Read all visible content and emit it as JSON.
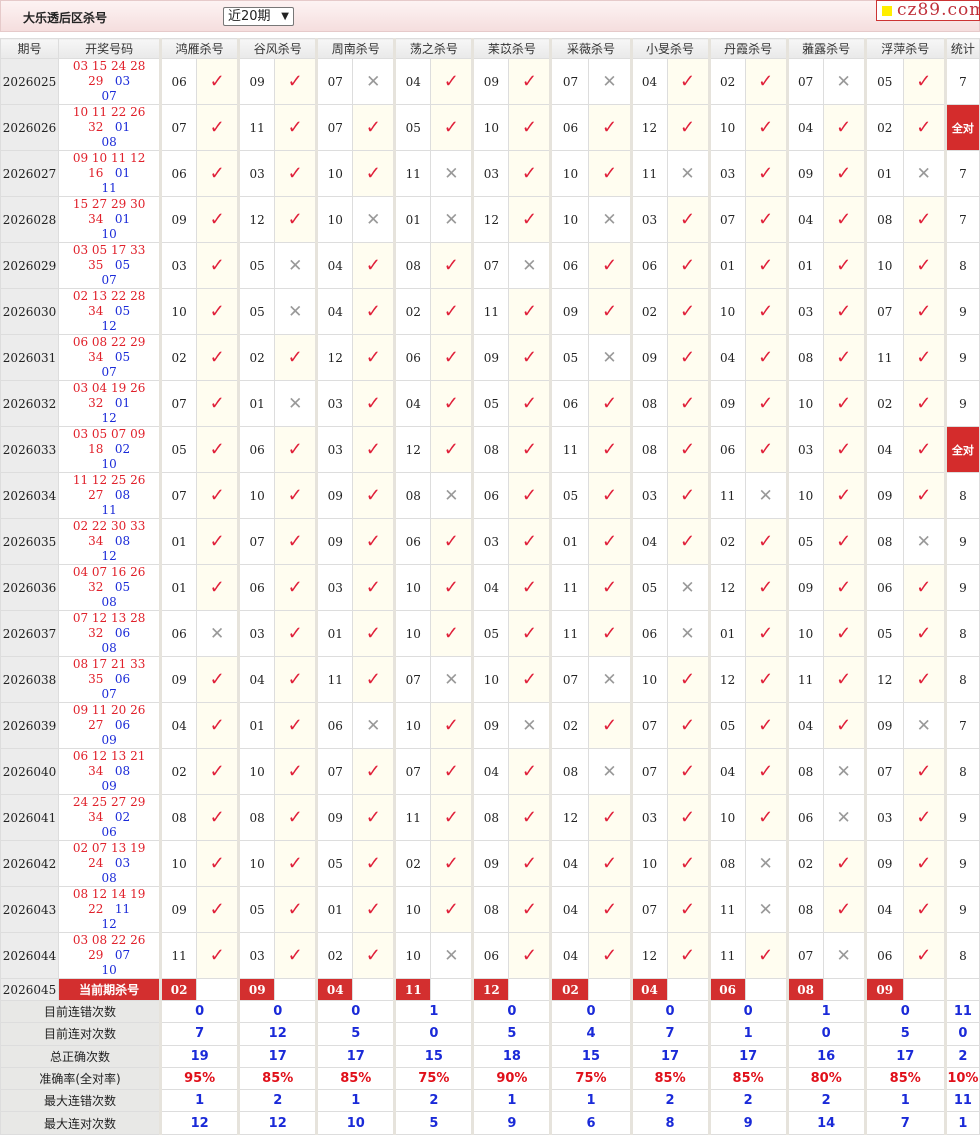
{
  "header": {
    "title": "大乐透后区杀号",
    "period_select": "近20期",
    "logo": "cz89.com"
  },
  "columns": {
    "period": "期号",
    "draw": "开奖号码",
    "stat": "统计"
  },
  "predictors": [
    "鸿雁杀号",
    "谷风杀号",
    "周南杀号",
    "荡之杀号",
    "苿苡杀号",
    "采薇杀号",
    "小旻杀号",
    "丹霞杀号",
    "蕥露杀号",
    "浮萍杀号"
  ],
  "rows": [
    {
      "period": "2026025",
      "red": "03 15 24 28 29",
      "blue": [
        "03",
        "07"
      ],
      "kills": [
        "06",
        "09",
        "07",
        "04",
        "09",
        "07",
        "04",
        "02",
        "07",
        "05"
      ],
      "stat": "7"
    },
    {
      "period": "2026026",
      "red": "10 11 22 26 32",
      "blue": [
        "01",
        "08"
      ],
      "kills": [
        "07",
        "11",
        "07",
        "05",
        "10",
        "06",
        "12",
        "10",
        "04",
        "02"
      ],
      "stat": "全对"
    },
    {
      "period": "2026027",
      "red": "09 10 11 12 16",
      "blue": [
        "01",
        "11"
      ],
      "kills": [
        "06",
        "03",
        "10",
        "11",
        "03",
        "10",
        "11",
        "03",
        "09",
        "01"
      ],
      "stat": "7"
    },
    {
      "period": "2026028",
      "red": "15 27 29 30 34",
      "blue": [
        "01",
        "10"
      ],
      "kills": [
        "09",
        "12",
        "10",
        "01",
        "12",
        "10",
        "03",
        "07",
        "04",
        "08"
      ],
      "stat": "7"
    },
    {
      "period": "2026029",
      "red": "03 05 17 33 35",
      "blue": [
        "05",
        "07"
      ],
      "kills": [
        "03",
        "05",
        "04",
        "08",
        "07",
        "06",
        "06",
        "01",
        "01",
        "10"
      ],
      "stat": "8"
    },
    {
      "period": "2026030",
      "red": "02 13 22 28 34",
      "blue": [
        "05",
        "12"
      ],
      "kills": [
        "10",
        "05",
        "04",
        "02",
        "11",
        "09",
        "02",
        "10",
        "03",
        "07"
      ],
      "stat": "9"
    },
    {
      "period": "2026031",
      "red": "06 08 22 29 34",
      "blue": [
        "05",
        "07"
      ],
      "kills": [
        "02",
        "02",
        "12",
        "06",
        "09",
        "05",
        "09",
        "04",
        "08",
        "11"
      ],
      "stat": "9"
    },
    {
      "period": "2026032",
      "red": "03 04 19 26 32",
      "blue": [
        "01",
        "12"
      ],
      "kills": [
        "07",
        "01",
        "03",
        "04",
        "05",
        "06",
        "08",
        "09",
        "10",
        "02"
      ],
      "stat": "9"
    },
    {
      "period": "2026033",
      "red": "03 05 07 09 18",
      "blue": [
        "02",
        "10"
      ],
      "kills": [
        "05",
        "06",
        "03",
        "12",
        "08",
        "11",
        "08",
        "06",
        "03",
        "04"
      ],
      "stat": "全对"
    },
    {
      "period": "2026034",
      "red": "11 12 25 26 27",
      "blue": [
        "08",
        "11"
      ],
      "kills": [
        "07",
        "10",
        "09",
        "08",
        "06",
        "05",
        "03",
        "11",
        "10",
        "09"
      ],
      "stat": "8"
    },
    {
      "period": "2026035",
      "red": "02 22 30 33 34",
      "blue": [
        "08",
        "12"
      ],
      "kills": [
        "01",
        "07",
        "09",
        "06",
        "03",
        "01",
        "04",
        "02",
        "05",
        "08"
      ],
      "stat": "9"
    },
    {
      "period": "2026036",
      "red": "04 07 16 26 32",
      "blue": [
        "05",
        "08"
      ],
      "kills": [
        "01",
        "06",
        "03",
        "10",
        "04",
        "11",
        "05",
        "12",
        "09",
        "06"
      ],
      "stat": "9"
    },
    {
      "period": "2026037",
      "red": "07 12 13 28 32",
      "blue": [
        "06",
        "08"
      ],
      "kills": [
        "06",
        "03",
        "01",
        "10",
        "05",
        "11",
        "06",
        "01",
        "10",
        "05"
      ],
      "stat": "8"
    },
    {
      "period": "2026038",
      "red": "08 17 21 33 35",
      "blue": [
        "06",
        "07"
      ],
      "kills": [
        "09",
        "04",
        "11",
        "07",
        "10",
        "07",
        "10",
        "12",
        "11",
        "12"
      ],
      "stat": "8"
    },
    {
      "period": "2026039",
      "red": "09 11 20 26 27",
      "blue": [
        "06",
        "09"
      ],
      "kills": [
        "04",
        "01",
        "06",
        "10",
        "09",
        "02",
        "07",
        "05",
        "04",
        "09"
      ],
      "stat": "7"
    },
    {
      "period": "2026040",
      "red": "06 12 13 21 34",
      "blue": [
        "08",
        "09"
      ],
      "kills": [
        "02",
        "10",
        "07",
        "07",
        "04",
        "08",
        "07",
        "04",
        "08",
        "07"
      ],
      "stat": "8"
    },
    {
      "period": "2026041",
      "red": "24 25 27 29 34",
      "blue": [
        "02",
        "06"
      ],
      "kills": [
        "08",
        "08",
        "09",
        "11",
        "08",
        "12",
        "03",
        "10",
        "06",
        "03"
      ],
      "stat": "9"
    },
    {
      "period": "2026042",
      "red": "02 07 13 19 24",
      "blue": [
        "03",
        "08"
      ],
      "kills": [
        "10",
        "10",
        "05",
        "02",
        "09",
        "04",
        "10",
        "08",
        "02",
        "09"
      ],
      "stat": "9"
    },
    {
      "period": "2026043",
      "red": "08 12 14 19 22",
      "blue": [
        "11",
        "12"
      ],
      "kills": [
        "09",
        "05",
        "01",
        "10",
        "08",
        "04",
        "07",
        "11",
        "08",
        "04"
      ],
      "stat": "9"
    },
    {
      "period": "2026044",
      "red": "03 08 22 26 29",
      "blue": [
        "07",
        "10"
      ],
      "kills": [
        "11",
        "03",
        "02",
        "10",
        "06",
        "04",
        "12",
        "11",
        "07",
        "06"
      ],
      "stat": "8"
    }
  ],
  "current": {
    "period": "2026045",
    "label": "当前期杀号",
    "kills": [
      "02",
      "09",
      "04",
      "11",
      "12",
      "02",
      "04",
      "06",
      "08",
      "09"
    ]
  },
  "stats": [
    {
      "label": "目前连错次数",
      "values": [
        "0",
        "0",
        "0",
        "1",
        "0",
        "0",
        "0",
        "0",
        "1",
        "0"
      ],
      "total": "11"
    },
    {
      "label": "目前连对次数",
      "values": [
        "7",
        "12",
        "5",
        "0",
        "5",
        "4",
        "7",
        "1",
        "0",
        "5"
      ],
      "total": "0"
    },
    {
      "label": "总正确次数",
      "values": [
        "19",
        "17",
        "17",
        "15",
        "18",
        "15",
        "17",
        "17",
        "16",
        "17"
      ],
      "total": "2"
    },
    {
      "label": "准确率(全对率)",
      "values": [
        "95%",
        "85%",
        "85%",
        "75%",
        "90%",
        "75%",
        "85%",
        "85%",
        "80%",
        "85%"
      ],
      "total": "10%"
    },
    {
      "label": "最大连错次数",
      "values": [
        "1",
        "2",
        "1",
        "2",
        "1",
        "1",
        "2",
        "2",
        "2",
        "1"
      ],
      "total": "11"
    },
    {
      "label": "最大连对次数",
      "values": [
        "12",
        "12",
        "10",
        "5",
        "9",
        "6",
        "8",
        "9",
        "14",
        "7"
      ],
      "total": "1"
    }
  ],
  "marks": {
    "hit": "✓",
    "miss": "✕"
  },
  "colors": {
    "accent": "#d32f2f",
    "red_ball": "#e0202a",
    "blue_ball": "#1a2ad8"
  }
}
